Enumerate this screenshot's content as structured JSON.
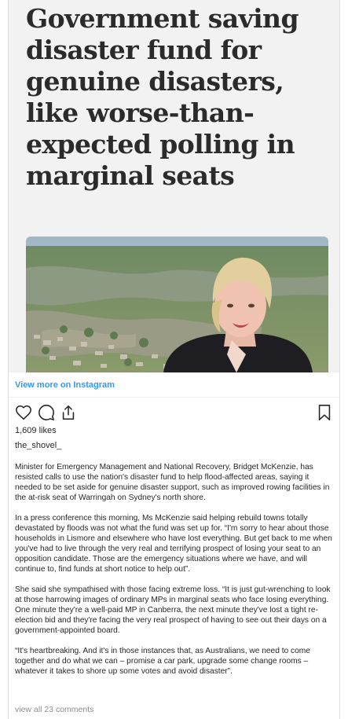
{
  "post": {
    "headline": "Government saving disaster fund for genuine disasters, like worse-than-expected polling in marginal seats",
    "view_more": "View more on Instagram",
    "likes": "1,609 likes",
    "username": "the_shovel_",
    "caption": [
      "Minister for Emergency Management and National Recovery, Bridget McKenzie, has resisted calls to use the nation's disaster fund to help flood-affected areas, saying it needed to be set aside for genuine disaster support, such as improved rowing facilities in the at-risk seat of Warringah on Sydney's north shore.",
      "In a press conference this morning, Ms McKenzie said helping rebuild towns totally devastated by floods was not what the fund was set up for. “I'm sorry to hear about those households in Lismore and elsewhere who have lost everything. But get back to me when you've had to live through the very real and terrifying prospect of losing your seat to an opposition candidate. Those are the emergency situations where we have, and will continue to, find funds at short notice to help out”.",
      "She said she sympathised with those facing extreme loss. “It is just gut-wrenching to look at those harrowing images of ordinary MPs in marginal seats who face losing everything. One minute they're a well-paid MP in Canberra, the next minute they've lost a tight re-election bid and they're facing the very real prospect of having to see out their days on a government-appointed board.",
      "“It's heartbreaking. And it's in those instances that, as Australians, we need to come together and do what we can – promise a car park, upgrade some change rooms – whatever it takes to shore up some votes and avoid disaster”."
    ],
    "view_comments": "view all 23 comments"
  },
  "icons": {
    "like": "heart-icon",
    "comment": "comment-icon",
    "share": "share-icon",
    "save": "bookmark-icon"
  },
  "colors": {
    "link": "#3897f0",
    "muted": "#8e8e8e",
    "text": "#262626",
    "headline": "#2b2b2b"
  }
}
